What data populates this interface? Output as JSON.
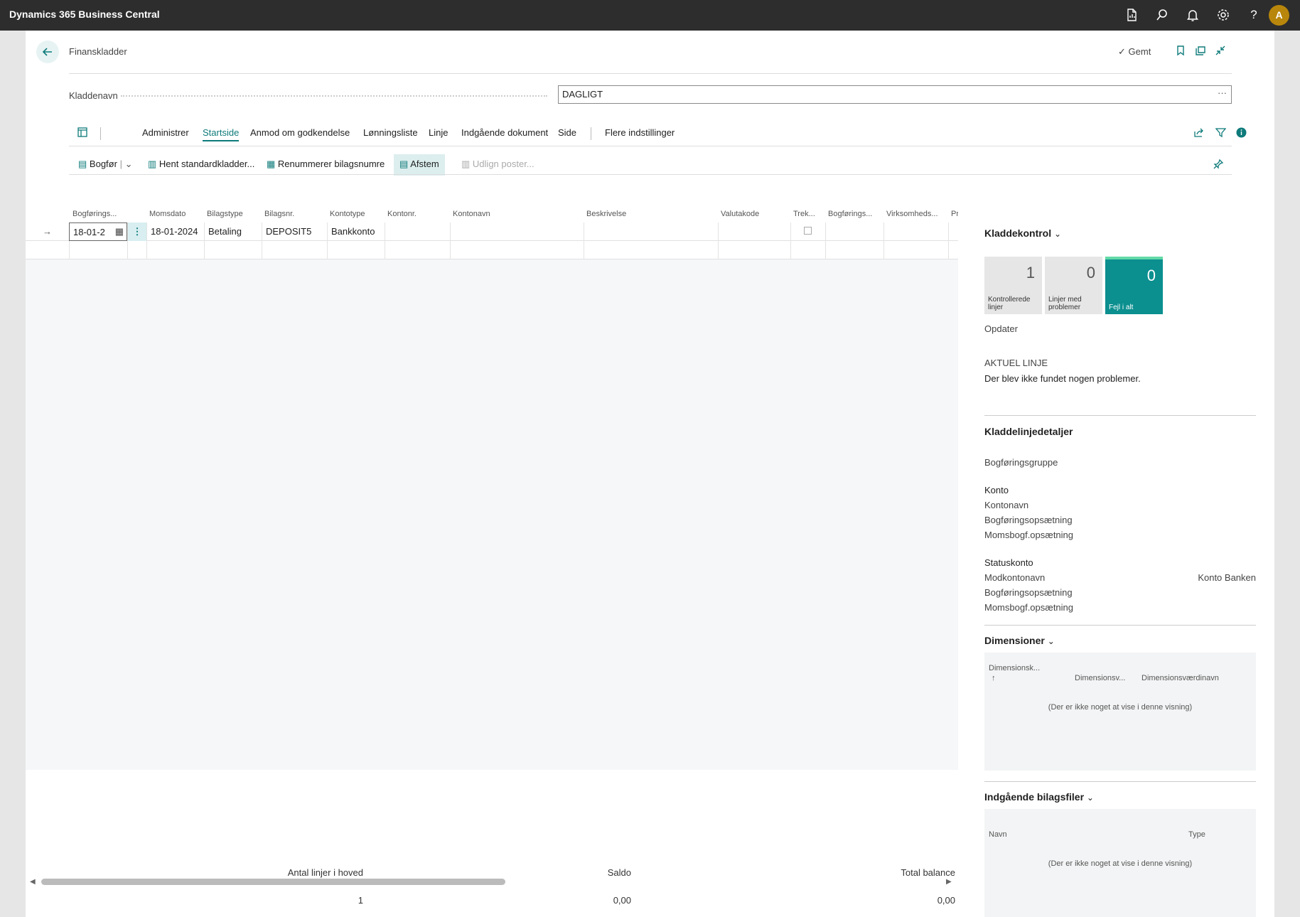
{
  "app": {
    "title": "Dynamics 365 Business Central",
    "avatar_initial": "A"
  },
  "header": {
    "breadcrumb": "Finanskladder",
    "saved_label": "Gemt"
  },
  "batch": {
    "label": "Kladdenavn",
    "value": "DAGLIGT"
  },
  "tabs": [
    "Administrer",
    "Startside",
    "Anmod om godkendelse",
    "Lønningsliste",
    "Linje",
    "Indgående dokument",
    "Side",
    "Flere indstillinger"
  ],
  "active_tab": "Startside",
  "actions": {
    "post": "Bogfør",
    "get_std": "Hent standardkladder...",
    "renumber": "Renummerer bilagsnumre",
    "reconcile": "Afstem",
    "apply": "Udlign poster..."
  },
  "grid": {
    "columns": [
      "Bogførings...",
      "Momsdato",
      "Bilagstype",
      "Bilagsnr.",
      "Kontotype",
      "Kontonr.",
      "Kontonavn",
      "Beskrivelse",
      "Valutakode",
      "Trek...",
      "Bogførings...",
      "Virksomheds...",
      "Pr"
    ],
    "row": {
      "posting_date": "18-01-2",
      "vat_date": "18-01-2024",
      "doc_type": "Betaling",
      "doc_no": "DEPOSIT5",
      "account_type": "Bankkonto"
    }
  },
  "totals": {
    "lines_label": "Antal linjer i hoved",
    "lines_value": "1",
    "balance_label": "Saldo",
    "balance_value": "0,00",
    "total_label": "Total balance",
    "total_value": "0,00"
  },
  "factbox": {
    "check_title": "Kladdekontrol",
    "tiles": [
      {
        "value": "1",
        "label": "Kontrollerede linjer"
      },
      {
        "value": "0",
        "label": "Linjer med problemer"
      },
      {
        "value": "0",
        "label": "Fejl i alt"
      }
    ],
    "update": "Opdater",
    "current_line": "AKTUEL LINJE",
    "no_problems": "Der blev ikke fundet nogen problemer.",
    "details_title": "Kladdelinjedetaljer",
    "posting_group": "Bogføringsgruppe",
    "account_h": "Konto",
    "account_name": "Kontonavn",
    "posting_setup": "Bogføringsopsætning",
    "vat_setup": "Momsbogf.opsætning",
    "status_h": "Statuskonto",
    "bal_account_name": "Modkontonavn",
    "bal_account_value": "Konto Banken",
    "posting_setup2": "Bogføringsopsætning",
    "vat_setup2": "Momsbogf.opsætning",
    "dim_title": "Dimensioner",
    "dim_cols": [
      "Dimensionsk...",
      "Dimensionsv...",
      "Dimensionsværdinavn"
    ],
    "dim_empty": "(Der er ikke noget at vise i denne visning)",
    "files_title": "Indgående bilagsfiler",
    "files_cols": [
      "Navn",
      "Type"
    ],
    "files_empty": "(Der er ikke noget at vise i denne visning)"
  }
}
